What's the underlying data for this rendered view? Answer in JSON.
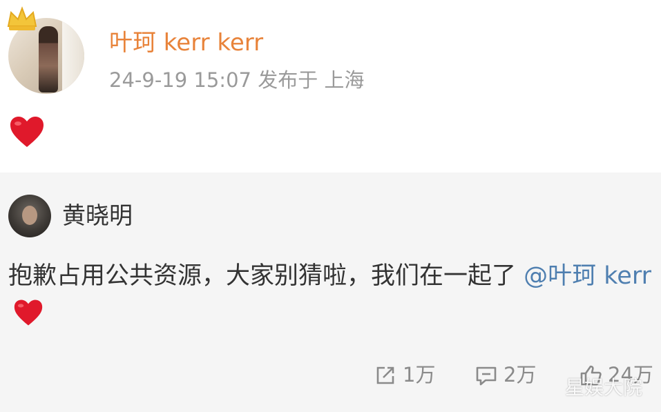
{
  "post": {
    "author": "叶珂 kerr kerr",
    "meta": "24-9-19 15:07  发布于 上海",
    "content_icon": "red-heart-emoji"
  },
  "repost": {
    "author": "黄晓明",
    "text": "抱歉占用公共资源，大家别猜啦，我们在一起了 ",
    "mention": "@叶珂 kerr",
    "trailing_icon": "red-heart-emoji",
    "stats": {
      "share": "1万",
      "comment": "2万",
      "like": "24万"
    }
  },
  "watermark": "星娱大院",
  "colors": {
    "author": "#e8833a",
    "mention": "#4f7fb0",
    "heart": "#e0192b",
    "repost_bg": "#f5f5f5"
  }
}
